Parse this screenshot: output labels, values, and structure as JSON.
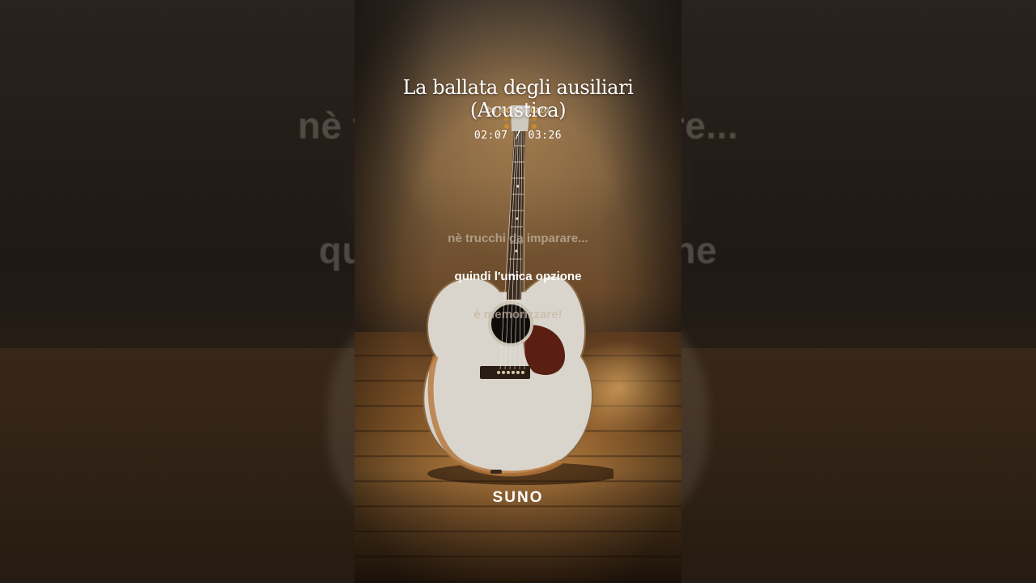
{
  "song": {
    "title": "La ballata degli ausiliari (Acustica)",
    "byline": "by lucapanozzo"
  },
  "player": {
    "time_display": "02:07 / 03:26"
  },
  "lyrics": {
    "previous": "nè trucchi da imparare...",
    "current": "quindi l'unica opzione",
    "next": "è memorizzare!"
  },
  "background_lyrics": {
    "line1": "nè trucchi da imparare...",
    "line2": "quindi l'unica opzione"
  },
  "brand": {
    "logo_text": "SUNO"
  },
  "colors": {
    "backdrop": "#141110",
    "lyric_active": "#ffffff",
    "lyric_inactive": "#c8b9a5"
  }
}
